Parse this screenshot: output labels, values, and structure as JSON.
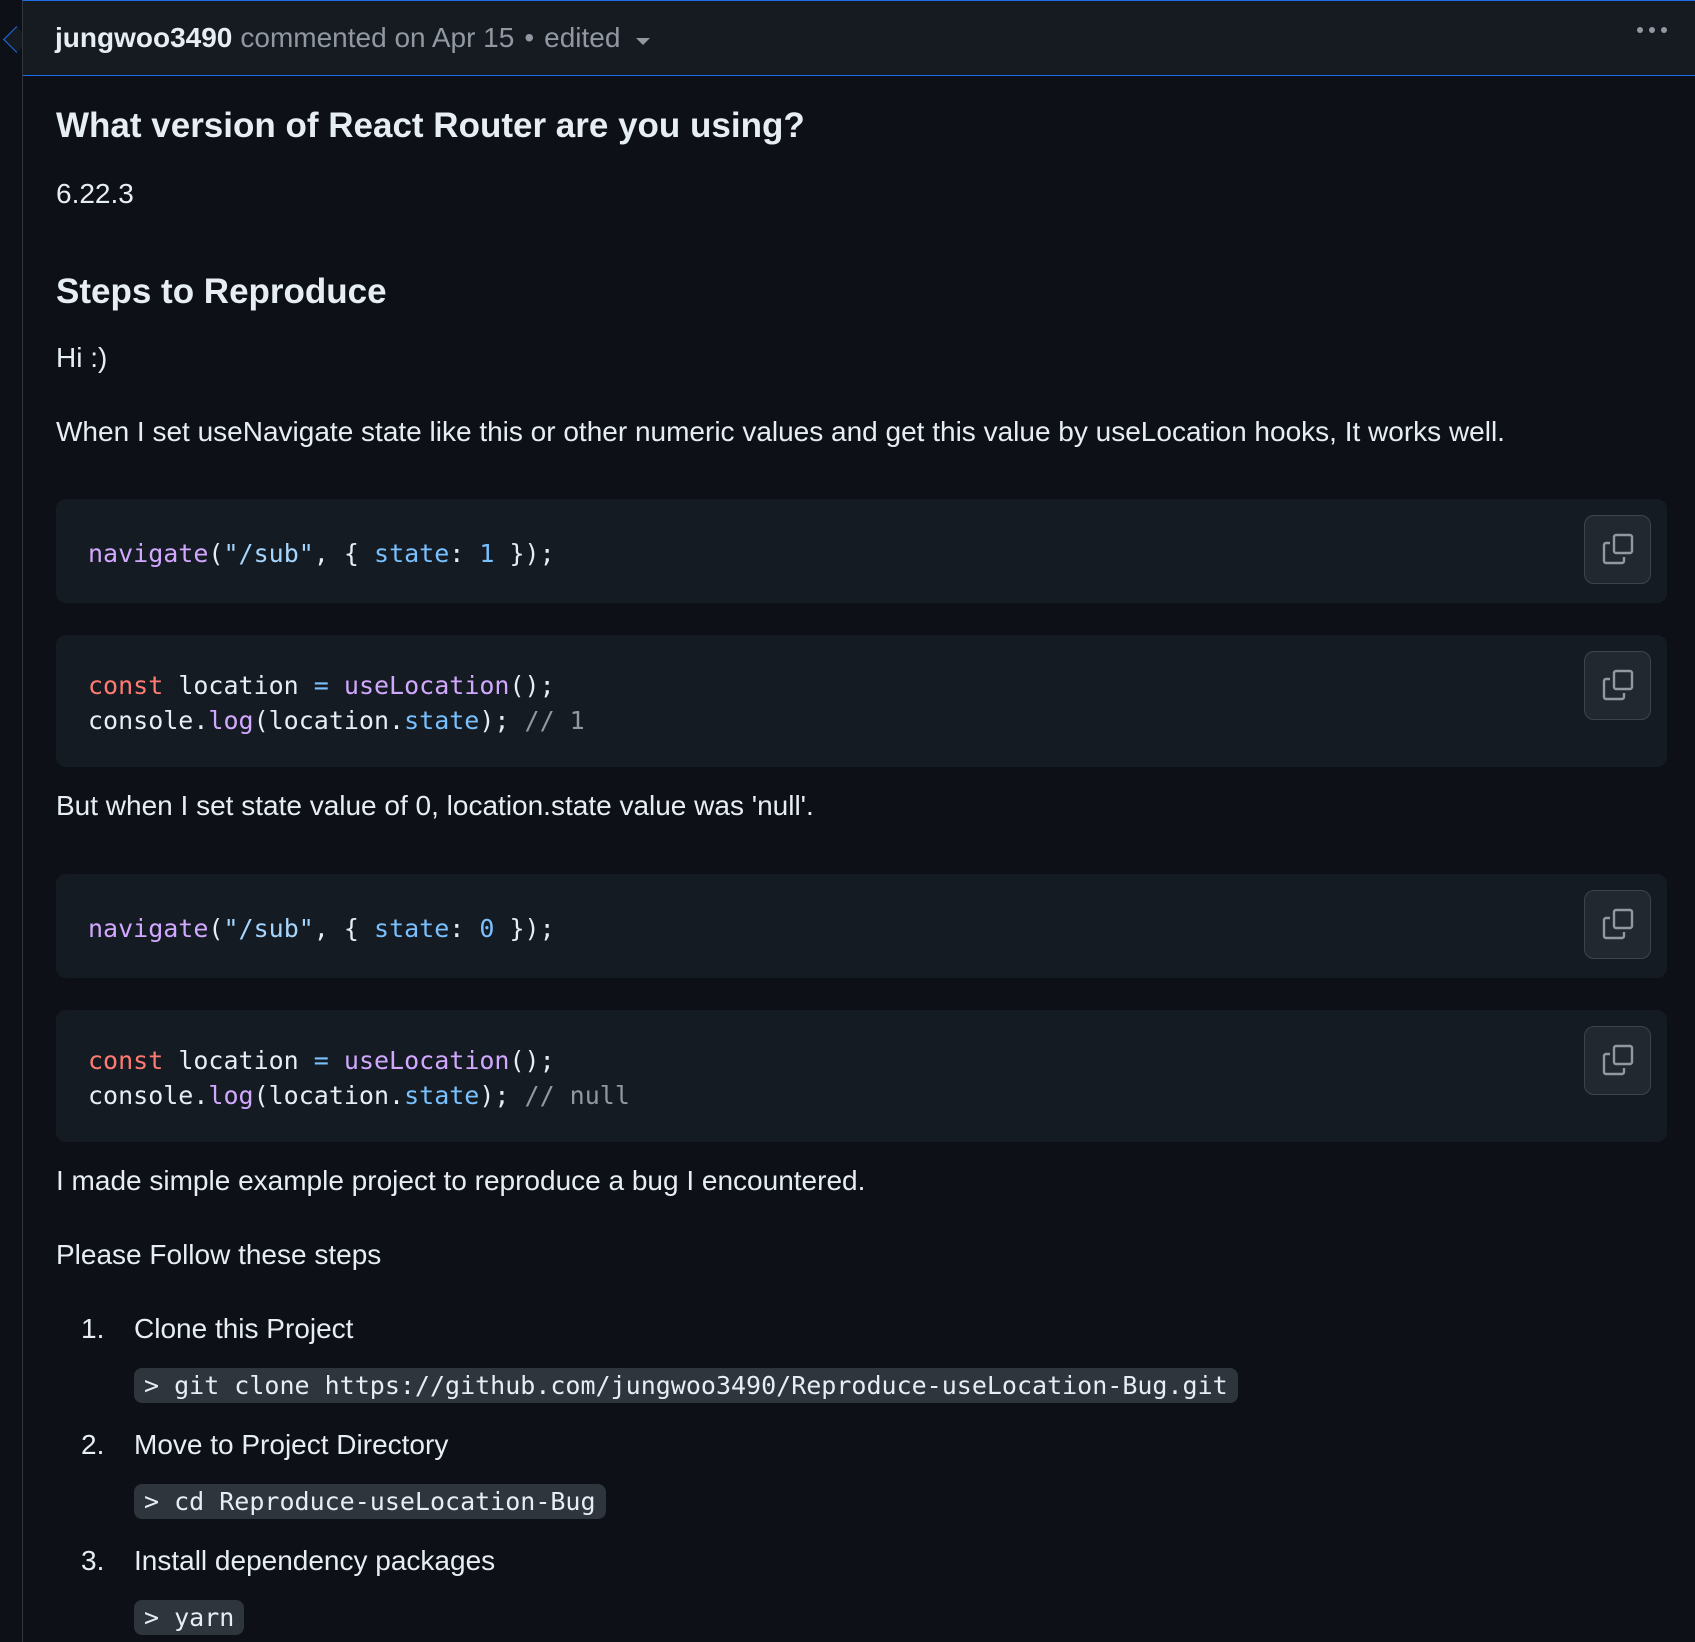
{
  "header": {
    "author": "jungwoo3490",
    "action": "commented on Apr 15",
    "separator": "•",
    "edited": "edited"
  },
  "content": {
    "heading_version": "What version of React Router are you using?",
    "version": "6.22.3",
    "heading_steps": "Steps to Reproduce",
    "greeting": "Hi :)",
    "intro": "When I set useNavigate state like this or other numeric values and get this value by useLocation hooks, It works well.",
    "but_text": "But when I set state value of 0, location.state value was 'null'.",
    "example_text": "I made simple example project to reproduce a bug I encountered.",
    "follow_text": "Please Follow these steps",
    "code_blocks": [
      {
        "tokens": [
          [
            [
              "fn",
              "navigate"
            ],
            [
              "",
              "("
            ],
            [
              "str",
              "\"/sub\""
            ],
            [
              "",
              ", { "
            ],
            [
              "prop",
              "state"
            ],
            [
              "",
              ": "
            ],
            [
              "num",
              "1"
            ],
            [
              "",
              " });"
            ]
          ]
        ]
      },
      {
        "tokens": [
          [
            [
              "kw",
              "const"
            ],
            [
              "",
              " location "
            ],
            [
              "op",
              "="
            ],
            [
              "",
              " "
            ],
            [
              "fn",
              "useLocation"
            ],
            [
              "",
              "();"
            ]
          ],
          [
            [
              "",
              "console."
            ],
            [
              "fn",
              "log"
            ],
            [
              "",
              "(location."
            ],
            [
              "prop",
              "state"
            ],
            [
              "",
              "); "
            ],
            [
              "cmt",
              "// 1"
            ]
          ]
        ]
      },
      {
        "tokens": [
          [
            [
              "fn",
              "navigate"
            ],
            [
              "",
              "("
            ],
            [
              "str",
              "\"/sub\""
            ],
            [
              "",
              ", { "
            ],
            [
              "prop",
              "state"
            ],
            [
              "",
              ": "
            ],
            [
              "num",
              "0"
            ],
            [
              "",
              " });"
            ]
          ]
        ]
      },
      {
        "tokens": [
          [
            [
              "kw",
              "const"
            ],
            [
              "",
              " location "
            ],
            [
              "op",
              "="
            ],
            [
              "",
              " "
            ],
            [
              "fn",
              "useLocation"
            ],
            [
              "",
              "();"
            ]
          ],
          [
            [
              "",
              "console."
            ],
            [
              "fn",
              "log"
            ],
            [
              "",
              "(location."
            ],
            [
              "prop",
              "state"
            ],
            [
              "",
              "); "
            ],
            [
              "cmt",
              "// null"
            ]
          ]
        ]
      }
    ],
    "steps": [
      {
        "num": "1.",
        "label": "Clone this Project",
        "command": "> git clone https://github.com/jungwoo3490/Reproduce-useLocation-Bug.git"
      },
      {
        "num": "2.",
        "label": "Move to Project Directory",
        "command": "> cd Reproduce-useLocation-Bug"
      },
      {
        "num": "3.",
        "label": "Install dependency packages",
        "command": "> yarn"
      }
    ]
  },
  "icons": {
    "copy": "copy-icon",
    "more": "kebab-horizontal-icon",
    "caret": "triangle-down-icon"
  }
}
